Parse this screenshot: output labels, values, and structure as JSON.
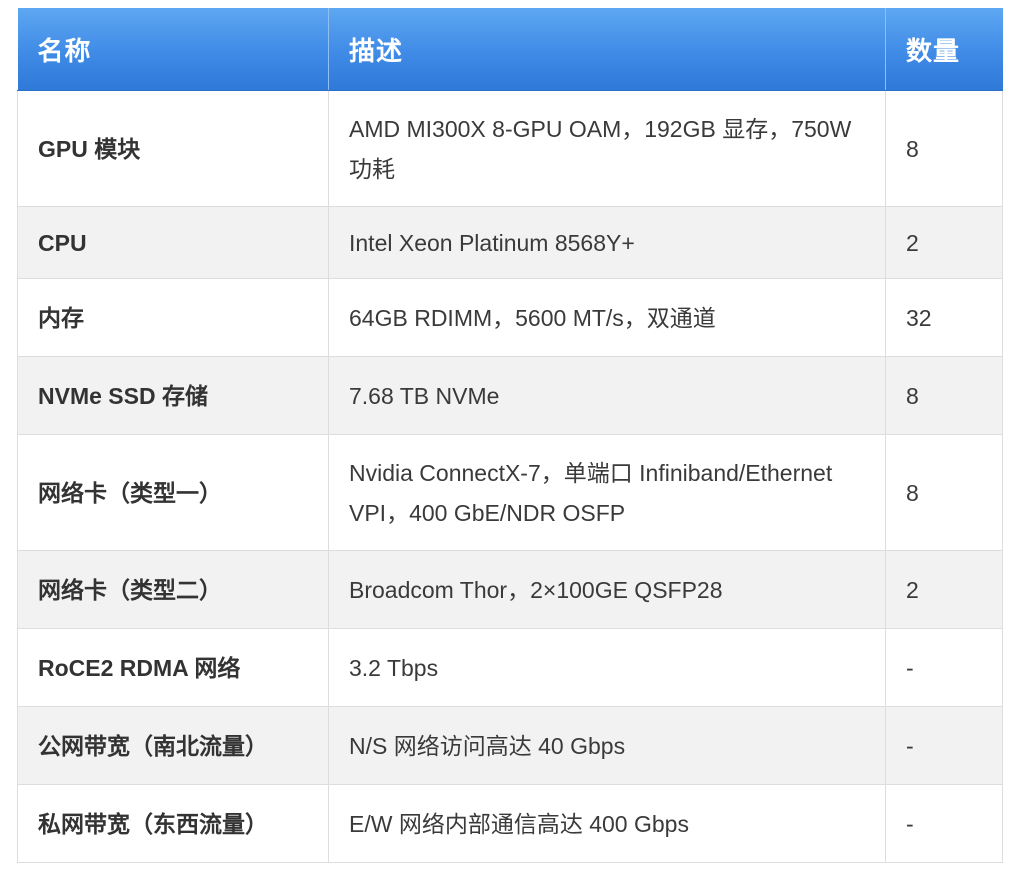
{
  "table": {
    "headers": {
      "name": "名称",
      "description": "描述",
      "quantity": "数量"
    },
    "rows": [
      {
        "name": "GPU 模块",
        "description": "AMD MI300X 8-GPU OAM，192GB 显存，750W 功耗",
        "quantity": "8"
      },
      {
        "name": "CPU",
        "description": "Intel Xeon Platinum 8568Y+",
        "quantity": "2"
      },
      {
        "name": "内存",
        "description": "64GB RDIMM，5600 MT/s，双通道",
        "quantity": "32"
      },
      {
        "name": "NVMe SSD 存储",
        "description": "7.68 TB NVMe",
        "quantity": "8"
      },
      {
        "name": "网络卡（类型一）",
        "description": "Nvidia ConnectX-7，单端口 Infiniband/Ethernet VPI，400 GbE/NDR OSFP",
        "quantity": "8"
      },
      {
        "name": "网络卡（类型二）",
        "description": "Broadcom Thor，2×100GE QSFP28",
        "quantity": "2"
      },
      {
        "name": "RoCE2 RDMA 网络",
        "description": "3.2 Tbps",
        "quantity": "-"
      },
      {
        "name": "公网带宽（南北流量）",
        "description": "N/S 网络访问高达 40 Gbps",
        "quantity": "-"
      },
      {
        "name": "私网带宽（东西流量）",
        "description": "E/W 网络内部通信高达 400 Gbps",
        "quantity": "-"
      }
    ]
  },
  "colors": {
    "header_background": "#3f8be6",
    "header_text": "#ffffff",
    "row_stripe": "#f2f2f2",
    "border": "#dddddd"
  }
}
